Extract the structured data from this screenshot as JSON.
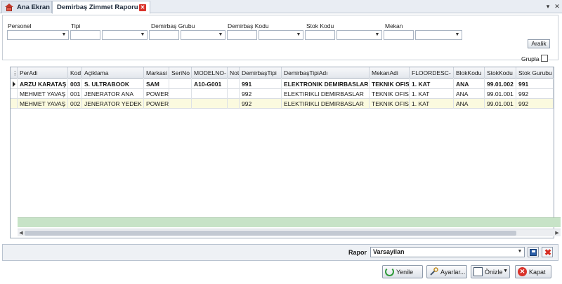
{
  "tabs": [
    {
      "label": "Ana Ekran"
    },
    {
      "label": "Demirbaş Zimmet Raporu"
    }
  ],
  "filters": {
    "personel_label": "Personel",
    "tipi_label": "Tipi",
    "grubu_label": "Demirbaş Grubu",
    "kodu_label": "Demirbaş Kodu",
    "stok_label": "Stok Kodu",
    "mekan_label": "Mekan",
    "aralik_label": "Aralik",
    "grupla_label": "Grupla"
  },
  "grid": {
    "columns": [
      "PerAdi",
      "Kod",
      "Açiklama",
      "Markasi",
      "SeriNo",
      "MODELNO-",
      "Not",
      "DemirbaşTipi",
      "DemirbaşTipiAdı",
      "MekanAdi",
      "FLOORDESC-",
      "BlokKodu",
      "StokKodu",
      "Stok Gurubu"
    ],
    "rows": [
      [
        "ARZU KARATAŞ",
        "003",
        "S. ULTRABOOK",
        "SAM",
        "",
        "A10-G001",
        "",
        "991",
        "ELEKTRONIK DEMIRBASLAR",
        "TEKNIK OFIS",
        "1. KAT",
        "ANA",
        "99.01.002",
        "991"
      ],
      [
        "MEHMET YAVAŞ",
        "001",
        "JENERATOR ANA",
        "POWER",
        "",
        "",
        "",
        "992",
        "ELEKTIRIKLI DEMIRBASLAR",
        "TEKNIK OFIS",
        "1. KAT",
        "ANA",
        "99.01.001",
        "992"
      ],
      [
        "MEHMET YAVAŞ",
        "002",
        "JENERATOR YEDEK",
        "POWER",
        "",
        "",
        "",
        "992",
        "ELEKTIRIKLI DEMIRBASLAR",
        "TEKNIK OFIS",
        "1. KAT",
        "ANA",
        "99.01.001",
        "992"
      ]
    ]
  },
  "report": {
    "label": "Rapor",
    "value": "Varsayilan"
  },
  "buttons": {
    "yenile": "Yenile",
    "ayarlar": "Ayarlar...",
    "onizle": "Önizle",
    "kapat": "Kapat"
  },
  "icons": {
    "home": "home-icon",
    "close_tab": "close-icon",
    "refresh": "refresh-icon",
    "settings": "wrench-icon",
    "preview": "preview-icon",
    "exit": "exit-icon",
    "save": "save-icon",
    "delete": "delete-icon"
  }
}
